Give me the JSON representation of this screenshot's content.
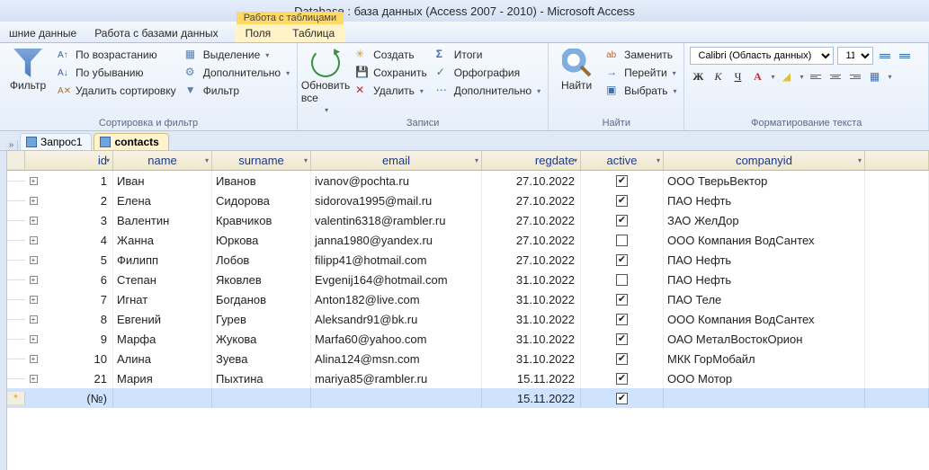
{
  "title": "Database : база данных (Access 2007 - 2010)  -  Microsoft Access",
  "menu": {
    "external_data": "шние данные",
    "db_tools": "Работа с базами данных",
    "table_tools_title": "Работа с таблицами",
    "fields": "Поля",
    "table": "Таблица"
  },
  "ribbon": {
    "filter": "Фильтр",
    "sort_asc": "По возрастанию",
    "sort_desc": "По убыванию",
    "clear_sort": "Удалить сортировку",
    "selection": "Выделение",
    "advanced": "Дополнительно",
    "filter_toggle": "Фильтр",
    "group_sort": "Сортировка и фильтр",
    "refresh_all": "Обновить все",
    "create": "Создать",
    "save": "Сохранить",
    "delete": "Удалить",
    "totals": "Итоги",
    "spelling": "Орфография",
    "more": "Дополнительно",
    "group_records": "Записи",
    "find": "Найти",
    "replace": "Заменить",
    "goto": "Перейти",
    "select": "Выбрать",
    "group_find": "Найти",
    "font_name": "Calibri (Область данных)",
    "font_size": "11",
    "group_format": "Форматирование текста"
  },
  "tabs": {
    "query1": "Запрос1",
    "contacts": "contacts"
  },
  "columns": {
    "id": "id",
    "name": "name",
    "surname": "surname",
    "email": "email",
    "regdate": "regdate",
    "active": "active",
    "companyid": "companyid"
  },
  "rows": [
    {
      "id": "1",
      "name": "Иван",
      "surname": "Иванов",
      "email": "ivanov@pochta.ru",
      "regdate": "27.10.2022",
      "active": true,
      "company": "ООО ТверьВектор"
    },
    {
      "id": "2",
      "name": "Елена",
      "surname": "Сидорова",
      "email": "sidorova1995@mail.ru",
      "regdate": "27.10.2022",
      "active": true,
      "company": "ПАО Нефть"
    },
    {
      "id": "3",
      "name": "Валентин",
      "surname": "Кравчиков",
      "email": "valentin6318@rambler.ru",
      "regdate": "27.10.2022",
      "active": true,
      "company": "ЗАО ЖелДор"
    },
    {
      "id": "4",
      "name": "Жанна",
      "surname": "Юркова",
      "email": "janna1980@yandex.ru",
      "regdate": "27.10.2022",
      "active": false,
      "company": "ООО Компания ВодСантех"
    },
    {
      "id": "5",
      "name": "Филипп",
      "surname": "Лобов",
      "email": "filipp41@hotmail.com",
      "regdate": "27.10.2022",
      "active": true,
      "company": "ПАО Нефть"
    },
    {
      "id": "6",
      "name": "Степан",
      "surname": "Яковлев",
      "email": "Evgenij164@hotmail.com",
      "regdate": "31.10.2022",
      "active": false,
      "company": "ПАО Нефть"
    },
    {
      "id": "7",
      "name": "Игнат",
      "surname": "Богданов",
      "email": "Anton182@live.com",
      "regdate": "31.10.2022",
      "active": true,
      "company": "ПАО Теле"
    },
    {
      "id": "8",
      "name": "Евгений",
      "surname": "Гурев",
      "email": "Aleksandr91@bk.ru",
      "regdate": "31.10.2022",
      "active": true,
      "company": "ООО Компания ВодСантех"
    },
    {
      "id": "9",
      "name": "Марфа",
      "surname": "Жукова",
      "email": "Marfa60@yahoo.com",
      "regdate": "31.10.2022",
      "active": true,
      "company": "ОАО МеталВостокОрион"
    },
    {
      "id": "10",
      "name": "Алина",
      "surname": "Зуева",
      "email": "Alina124@msn.com",
      "regdate": "31.10.2022",
      "active": true,
      "company": "МКК ГорМобайл"
    },
    {
      "id": "21",
      "name": "Мария",
      "surname": "Пыхтина",
      "email": "mariya85@rambler.ru",
      "regdate": "15.11.2022",
      "active": true,
      "company": "ООО Мотор"
    }
  ],
  "new_row": {
    "id_placeholder": "(№)",
    "regdate": "15.11.2022",
    "active": true
  }
}
